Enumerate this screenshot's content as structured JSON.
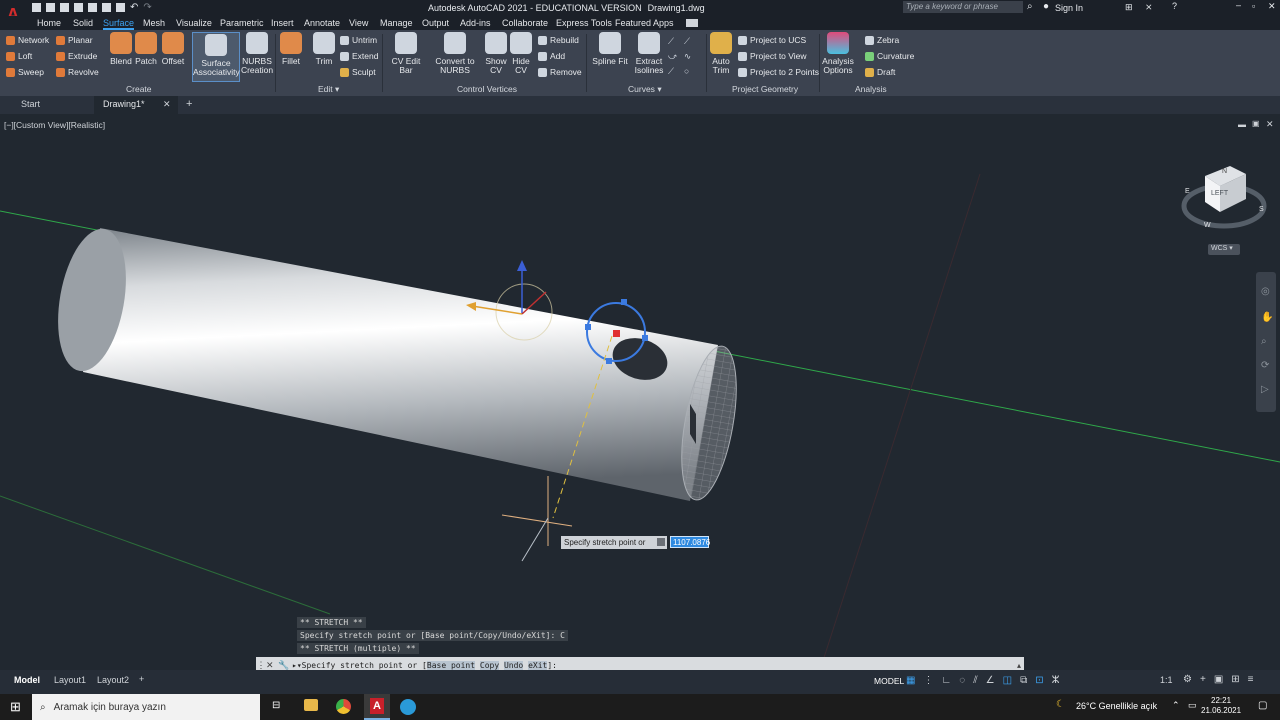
{
  "app": {
    "title": "Autodesk AutoCAD 2021 - EDUCATIONAL VERSION",
    "file": "Drawing1.dwg",
    "search_placeholder": "Type a keyword or phrase",
    "sign_in": "Sign In",
    "logo": "A"
  },
  "menu": {
    "items": [
      "Home",
      "Solid",
      "Surface",
      "Mesh",
      "Visualize",
      "Parametric",
      "Insert",
      "Annotate",
      "View",
      "Manage",
      "Output",
      "Add-ins",
      "Collaborate",
      "Express Tools",
      "Featured Apps"
    ],
    "active": "Surface"
  },
  "ribbon": {
    "create": {
      "title": "Create",
      "small": [
        "Network",
        "Loft",
        "Sweep",
        "Planar",
        "Extrude",
        "Revolve"
      ],
      "big": [
        "Blend",
        "Patch",
        "Offset",
        "Surface Associativity",
        "NURBS Creation"
      ]
    },
    "edit": {
      "title": "Edit",
      "big": [
        "Fillet",
        "Trim"
      ],
      "small": [
        "Untrim",
        "Extend",
        "Sculpt"
      ]
    },
    "cv": {
      "title": "Control Vertices",
      "big": [
        "CV Edit Bar",
        "Convert to NURBS",
        "Show CV",
        "Hide CV"
      ],
      "small": [
        "Rebuild",
        "Add",
        "Remove"
      ]
    },
    "curves": {
      "title": "Curves",
      "big": [
        "Spline Fit",
        "Extract Isolines"
      ]
    },
    "proj": {
      "title": "Project Geometry",
      "big": [
        "Auto Trim"
      ],
      "small": [
        "Project to UCS",
        "Project to View",
        "Project to 2 Points"
      ]
    },
    "analysis": {
      "title": "Analysis",
      "big": [
        "Analysis Options"
      ],
      "small": [
        "Zebra",
        "Curvature",
        "Draft"
      ]
    }
  },
  "doctabs": {
    "start": "Start",
    "drawing": "Drawing1*",
    "add": "+"
  },
  "viewport": {
    "label": "[−][Custom View][Realistic]",
    "cube_face": "LEFT",
    "wcs": "WCS",
    "compass": [
      "N",
      "S",
      "W",
      "E"
    ]
  },
  "tooltip": {
    "prompt": "Specify stretch point or",
    "value": "1107.0876"
  },
  "command": {
    "history": [
      "** STRETCH **",
      "Specify stretch point or [Base point/Copy/Undo/eXit]: C",
      "** STRETCH (multiple) **"
    ],
    "prompt": "Specify stretch point or",
    "options": [
      "Base point",
      "Copy",
      "Undo",
      "eXit"
    ]
  },
  "layouts": {
    "tabs": [
      "Model",
      "Layout1",
      "Layout2"
    ],
    "add": "+"
  },
  "status": {
    "model": "MODEL",
    "scale": "1:1"
  },
  "taskbar": {
    "search": "Aramak için buraya yazın",
    "weather": "26°C  Genellikle açık",
    "time": "22:21",
    "date": "21.06.2021"
  },
  "colors": {
    "accent": "#3da2f0",
    "bg": "#212830",
    "ribbon": "#3c4350",
    "grip_blue": "#3b7ae0",
    "grip_red": "#e03030"
  }
}
